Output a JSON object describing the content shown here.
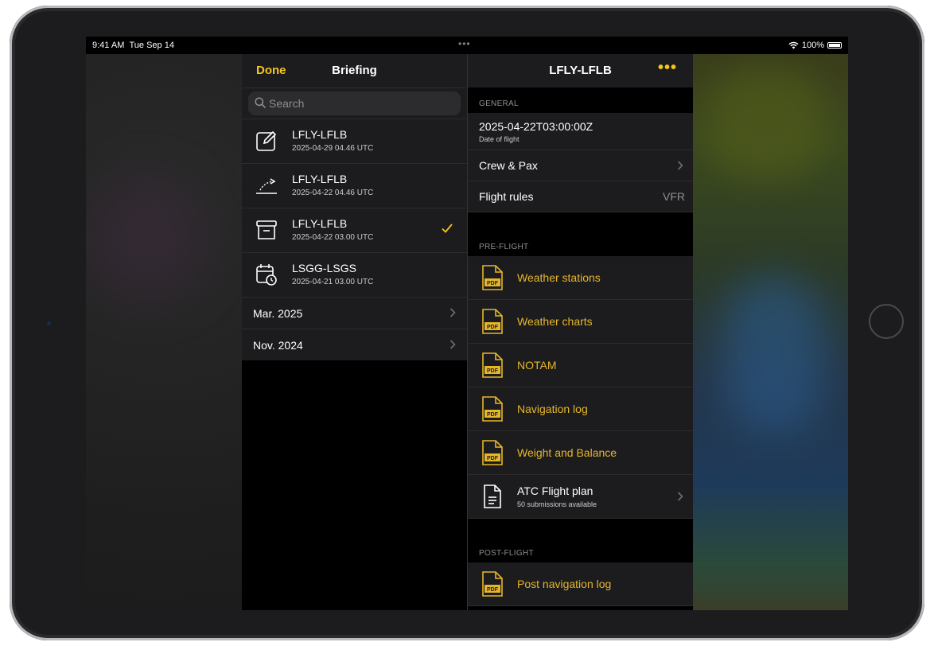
{
  "status_bar": {
    "time": "9:41 AM",
    "date": "Tue Sep 14",
    "battery": "100%"
  },
  "left_panel": {
    "done_label": "Done",
    "title": "Briefing",
    "search_placeholder": "Search",
    "briefings": [
      {
        "icon": "edit-icon",
        "title": "LFLY-LFLB",
        "subtitle": "2025-04-29 04.46 UTC",
        "selected": false
      },
      {
        "icon": "departure-icon",
        "title": "LFLY-LFLB",
        "subtitle": "2025-04-22 04.46 UTC",
        "selected": false
      },
      {
        "icon": "archive-icon",
        "title": "LFLY-LFLB",
        "subtitle": "2025-04-22 03.00 UTC",
        "selected": true
      },
      {
        "icon": "calendar-clock-icon",
        "title": "LSGG-LSGS",
        "subtitle": "2025-04-21 03.00 UTC",
        "selected": false
      }
    ],
    "months": [
      {
        "label": "Mar. 2025"
      },
      {
        "label": "Nov. 2024"
      }
    ]
  },
  "right_panel": {
    "title": "LFLY-LFLB",
    "more_label": "•••",
    "general": {
      "section_label": "GENERAL",
      "date_value": "2025-04-22T03:00:00Z",
      "date_sublabel": "Date of flight",
      "crew_label": "Crew & Pax",
      "rules_label": "Flight rules",
      "rules_value": "VFR"
    },
    "pre_flight": {
      "section_label": "PRE-FLIGHT",
      "items": [
        {
          "label": "Weather stations"
        },
        {
          "label": "Weather charts"
        },
        {
          "label": "NOTAM"
        },
        {
          "label": "Navigation log"
        },
        {
          "label": "Weight and Balance"
        }
      ],
      "atc_label": "ATC Flight plan",
      "atc_sub": "50 submissions available"
    },
    "post_flight": {
      "section_label": "POST-FLIGHT",
      "items": [
        {
          "label": "Post navigation log"
        }
      ]
    },
    "pdf_badge": "PDF"
  },
  "colors": {
    "accent": "#f5c518",
    "pdf_text": "#e5b62a",
    "cell_bg": "#1c1c1e"
  }
}
